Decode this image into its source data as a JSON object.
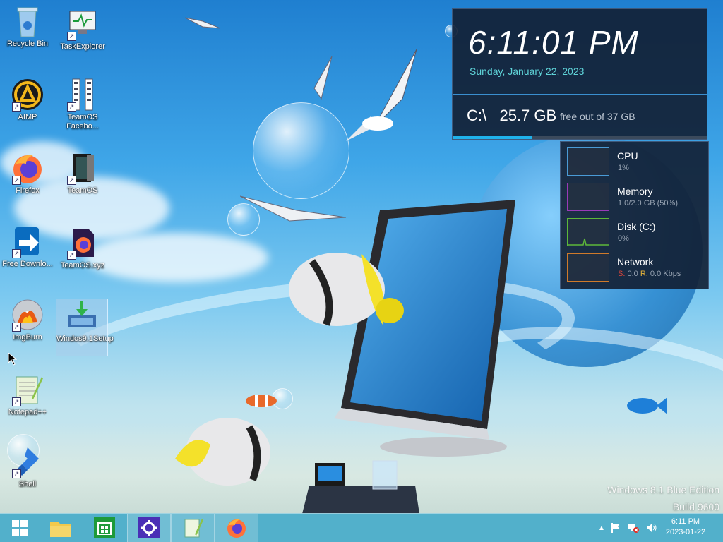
{
  "desktop": {
    "icons": [
      {
        "label": "Recycle Bin"
      },
      {
        "label": "TaskExplorer"
      },
      {
        "label": "AIMP"
      },
      {
        "label": "TeamOS Facebo..."
      },
      {
        "label": "Firefox"
      },
      {
        "label": "TeamOS"
      },
      {
        "label": "Free Downlo..."
      },
      {
        "label": "TeamOS.xyz"
      },
      {
        "label": "ImgBurn"
      },
      {
        "label": "Windos9.1Setup"
      },
      {
        "label": "Notepad++"
      },
      {
        "label": "Shell"
      }
    ]
  },
  "clock_gadget": {
    "time": "6:11:01 PM",
    "date": "Sunday, January 22, 2023",
    "drive": "C:\\",
    "free_size": "25.7 GB",
    "free_text": "free out of 37 GB",
    "used_fraction": 0.31
  },
  "resource_gadget": {
    "cpu": {
      "name": "CPU",
      "value": "1%",
      "color": "#4a9bd6"
    },
    "memory": {
      "name": "Memory",
      "value": "1.0/2.0 GB (50%)",
      "color": "#9a3ab8"
    },
    "disk": {
      "name": "Disk (C:)",
      "value": "0%",
      "color": "#5cb83a"
    },
    "network": {
      "name": "Network",
      "s_label": "S:",
      "s_value": "0.0",
      "r_label": "R:",
      "r_value": "0.0 Kbps",
      "color": "#d07a2a"
    }
  },
  "watermark": {
    "edition": "Windows 8.1 Blue Edition",
    "build": "Build 9600"
  },
  "taskbar": {
    "items": [
      "start",
      "file-explorer",
      "store",
      "settings",
      "notepad-plus-plus",
      "firefox"
    ],
    "clock_time": "6:11 PM",
    "clock_date": "2023-01-22"
  }
}
